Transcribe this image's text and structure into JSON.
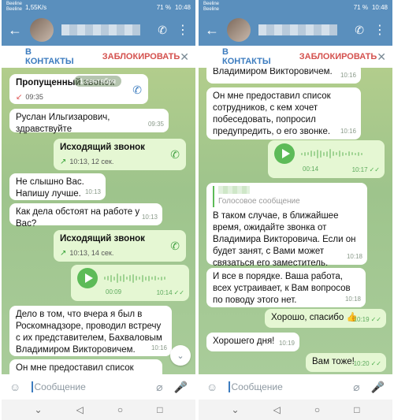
{
  "status_left": {
    "carrier1": "Beeline",
    "carrier2": "Beeline",
    "speed": "1,55K/s",
    "battery": "71 %",
    "time": "10:48"
  },
  "status_right": {
    "carrier1": "Beeline",
    "carrier2": "Beeline",
    "battery": "71 %",
    "time": "10:48"
  },
  "actions": {
    "contacts": "В КОНТАКТЫ",
    "block": "ЗАБЛОКИРОВАТЬ"
  },
  "input": {
    "placeholder": "Сообщение"
  },
  "left_chat": {
    "date_badge": "1 сентября",
    "missed_call": {
      "title": "Пропущенный звонок",
      "time": "09:35"
    },
    "m1": {
      "text": "Руслан Ильгизарович, здравствуйте",
      "time": "09:35"
    },
    "out_call1": {
      "title": "Исходящий звонок",
      "detail": "10:13, 12 сек."
    },
    "m2": {
      "text": "Не слышно Вас. Напишу лучше.",
      "time": "10:13"
    },
    "m3": {
      "text": "Как дела обстоят на работе у Вас?",
      "time": "10:13"
    },
    "out_call2": {
      "title": "Исходящий звонок",
      "detail": "10:13, 14 сек."
    },
    "voice1": {
      "duration": "00:09",
      "time": "10:14"
    },
    "m4": {
      "text": "Дело в том, что вчера я был в Роскомнадзоре, проводил встречу с их представителем, Бахваловым Владимиром Викторовичем.",
      "time": "10:16"
    },
    "m5": {
      "text": "Он мне предоставил список"
    }
  },
  "right_chat": {
    "m0": {
      "text": "Владимиром Викторовичем.",
      "time": "10:16"
    },
    "m1": {
      "text": "Он мне предоставил список сотрудников, с кем хочет побеседовать, попросил предупредить, о его звонке.",
      "time": "10:16"
    },
    "voice1": {
      "duration": "00:14",
      "time": "10:17"
    },
    "m2": {
      "quote": "Голосовое сообщение",
      "text": "В таком случае, в ближайшее время, ожидайте звонка от Владимира Викторовича. Если он будет занят, с Вами может связаться его заместитель. Максимова М. В.",
      "time": "10:18"
    },
    "m3": {
      "text": "И все в порядке. Ваша работа, всех устраивает, к Вам вопросов по поводу этого нет.",
      "time": "10:18"
    },
    "m4": {
      "text": "Хорошо, спасибо 👍",
      "time": "10:19"
    },
    "m5": {
      "text": "Хорошего дня!",
      "time": "10:19"
    },
    "m6": {
      "text": "Вам тоже!",
      "time": "10:20"
    }
  }
}
